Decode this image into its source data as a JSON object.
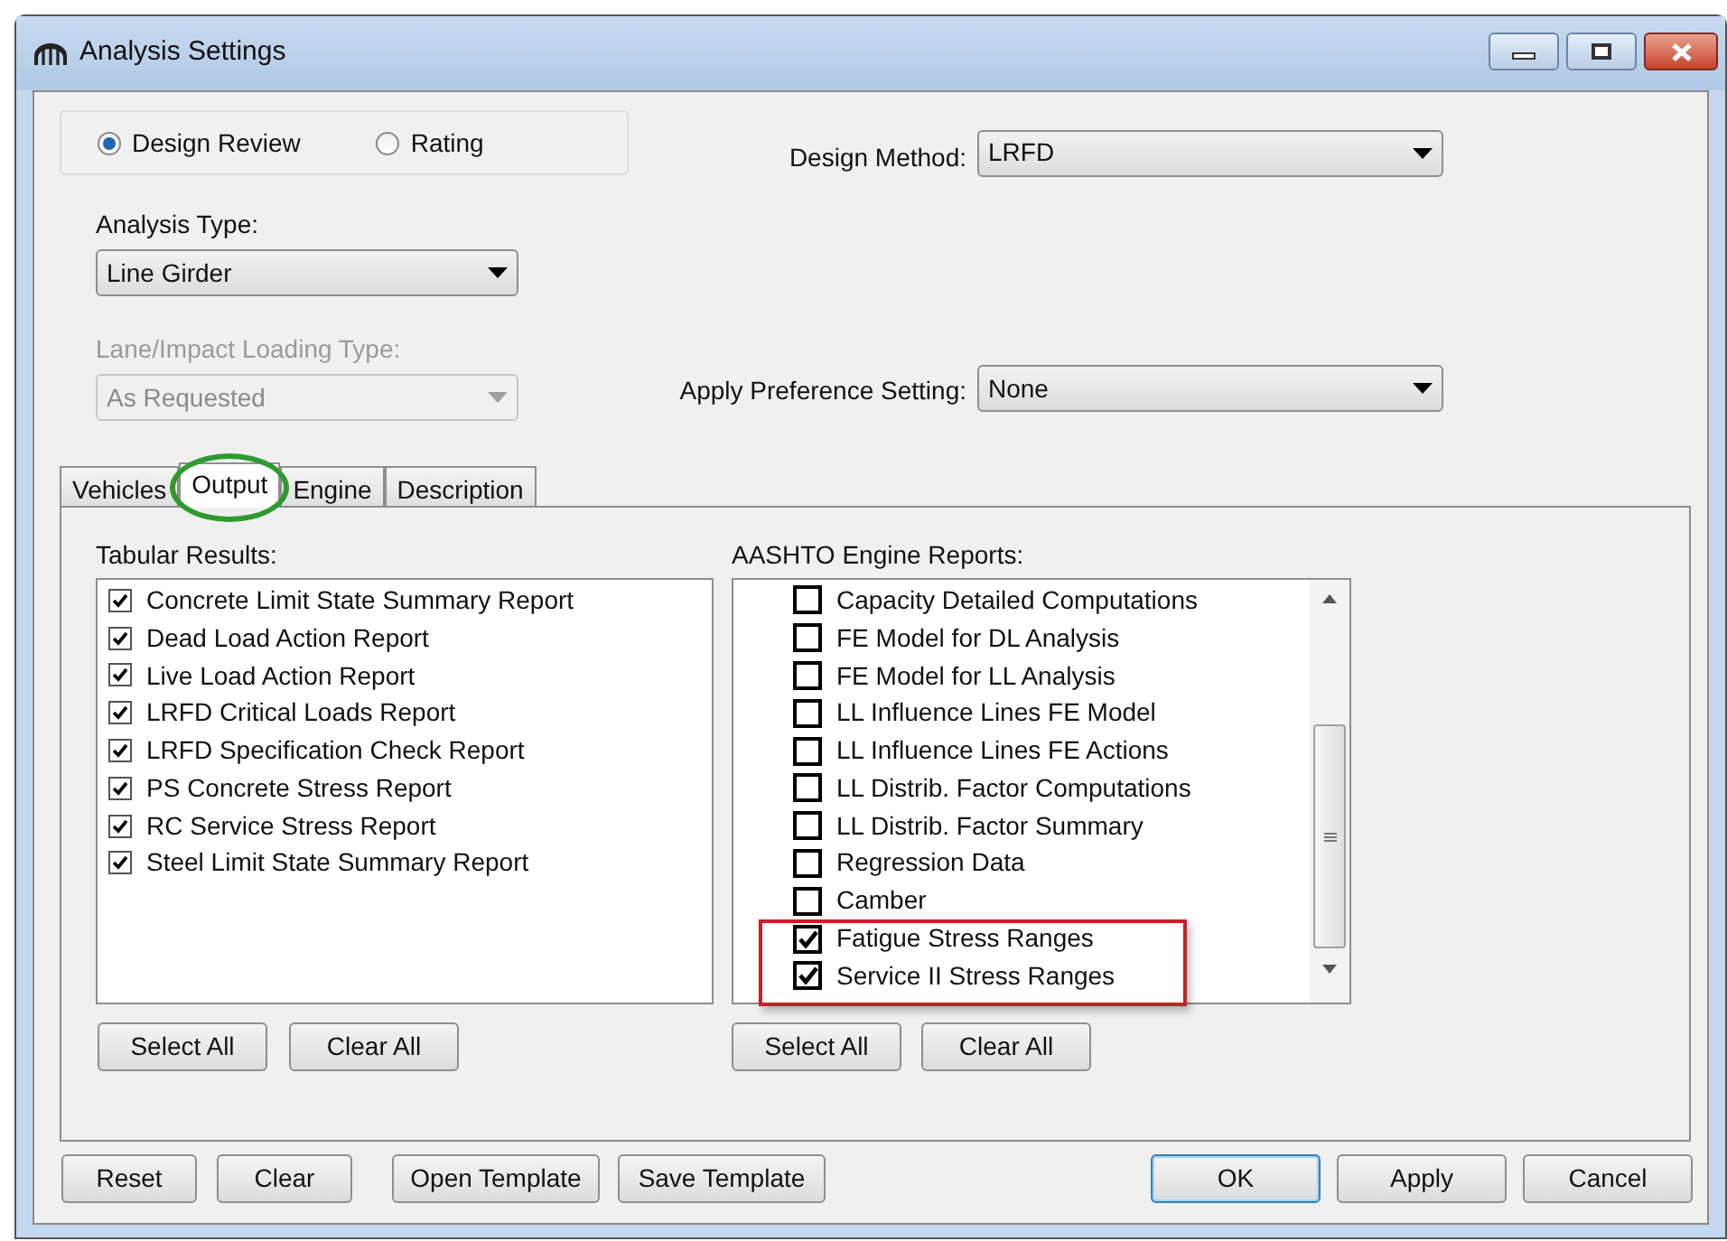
{
  "window": {
    "title": "Analysis Settings"
  },
  "mode_options": [
    {
      "label": "Design Review",
      "selected": true
    },
    {
      "label": "Rating",
      "selected": false
    }
  ],
  "design_method": {
    "label": "Design Method:",
    "value": "LRFD",
    "disabled": false
  },
  "analysis_type": {
    "label": "Analysis Type:",
    "value": "Line Girder",
    "disabled": false
  },
  "loading_type": {
    "label": "Lane/Impact Loading Type:",
    "value": "As Requested",
    "disabled": true
  },
  "preference": {
    "label": "Apply Preference Setting:",
    "value": "None",
    "disabled": false
  },
  "tabs": [
    {
      "label": "Vehicles",
      "selected": false
    },
    {
      "label": "Output",
      "selected": true
    },
    {
      "label": "Engine",
      "selected": false
    },
    {
      "label": "Description",
      "selected": false
    }
  ],
  "tabular_results": {
    "label": "Tabular Results:",
    "items": [
      {
        "label": "Concrete Limit State Summary Report",
        "checked": true
      },
      {
        "label": "Dead Load Action Report",
        "checked": true
      },
      {
        "label": "Live Load Action Report",
        "checked": true
      },
      {
        "label": "LRFD Critical Loads Report",
        "checked": true
      },
      {
        "label": "LRFD Specification Check Report",
        "checked": true
      },
      {
        "label": "PS Concrete Stress Report",
        "checked": true
      },
      {
        "label": "RC Service Stress Report",
        "checked": true
      },
      {
        "label": "Steel Limit State Summary Report",
        "checked": true
      }
    ],
    "buttons": [
      "Select All",
      "Clear All"
    ]
  },
  "engine_reports": {
    "label": "AASHTO Engine Reports:",
    "items": [
      {
        "label": "Capacity Detailed Computations",
        "checked": false
      },
      {
        "label": "FE Model for DL Analysis",
        "checked": false
      },
      {
        "label": "FE Model for LL Analysis",
        "checked": false
      },
      {
        "label": "LL Influence Lines FE Model",
        "checked": false
      },
      {
        "label": "LL Influence Lines FE Actions",
        "checked": false
      },
      {
        "label": "LL Distrib. Factor Computations",
        "checked": false
      },
      {
        "label": "LL Distrib. Factor Summary",
        "checked": false
      },
      {
        "label": "Regression Data",
        "checked": false
      },
      {
        "label": "Camber",
        "checked": false
      },
      {
        "label": "Fatigue Stress Ranges",
        "checked": true
      },
      {
        "label": "Service II Stress Ranges",
        "checked": true
      }
    ],
    "buttons": [
      "Select All",
      "Clear All"
    ]
  },
  "footer_left": [
    "Reset",
    "Clear",
    "Open Template",
    "Save Template"
  ],
  "footer_right": [
    {
      "label": "OK",
      "default": true
    },
    {
      "label": "Apply",
      "default": false
    },
    {
      "label": "Cancel",
      "default": false
    }
  ]
}
